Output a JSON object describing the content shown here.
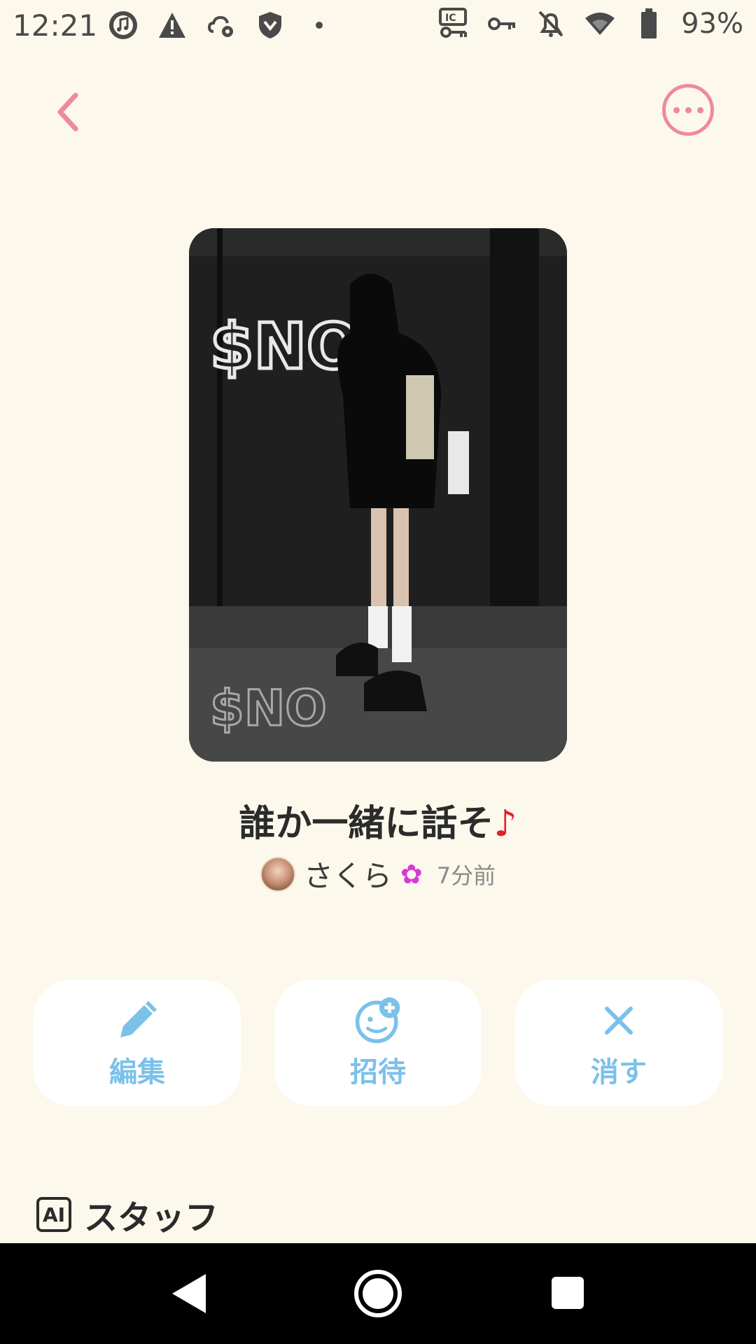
{
  "status_bar": {
    "time": "12:21",
    "battery_percent": "93%",
    "left_icons": [
      "music-icon",
      "warning-icon",
      "settings-cloud-icon",
      "shield-icon",
      "dot-icon"
    ],
    "right_icons": [
      "vpn-key-icon",
      "key-icon",
      "notifications-off-icon",
      "wifi-icon",
      "battery-icon"
    ]
  },
  "header": {
    "back_icon": "chevron-left-icon",
    "more_icon": "more-horizontal-icon",
    "accent_color": "#ef8a96"
  },
  "post": {
    "title": "誰か一緒に話そ",
    "title_emoji": "♪",
    "author_name": "さくら",
    "author_decoration": "✿",
    "time_ago": "7分前"
  },
  "actions": [
    {
      "label": "編集",
      "icon": "pencil-icon"
    },
    {
      "label": "招待",
      "icon": "invite-face-icon"
    },
    {
      "label": "消す",
      "icon": "close-icon"
    }
  ],
  "action_color": "#7bc1ea",
  "staff": {
    "badge": "AI",
    "label": "スタッフ"
  },
  "nav_bar": {
    "icons": [
      "nav-back-icon",
      "nav-home-icon",
      "nav-recents-icon"
    ]
  }
}
